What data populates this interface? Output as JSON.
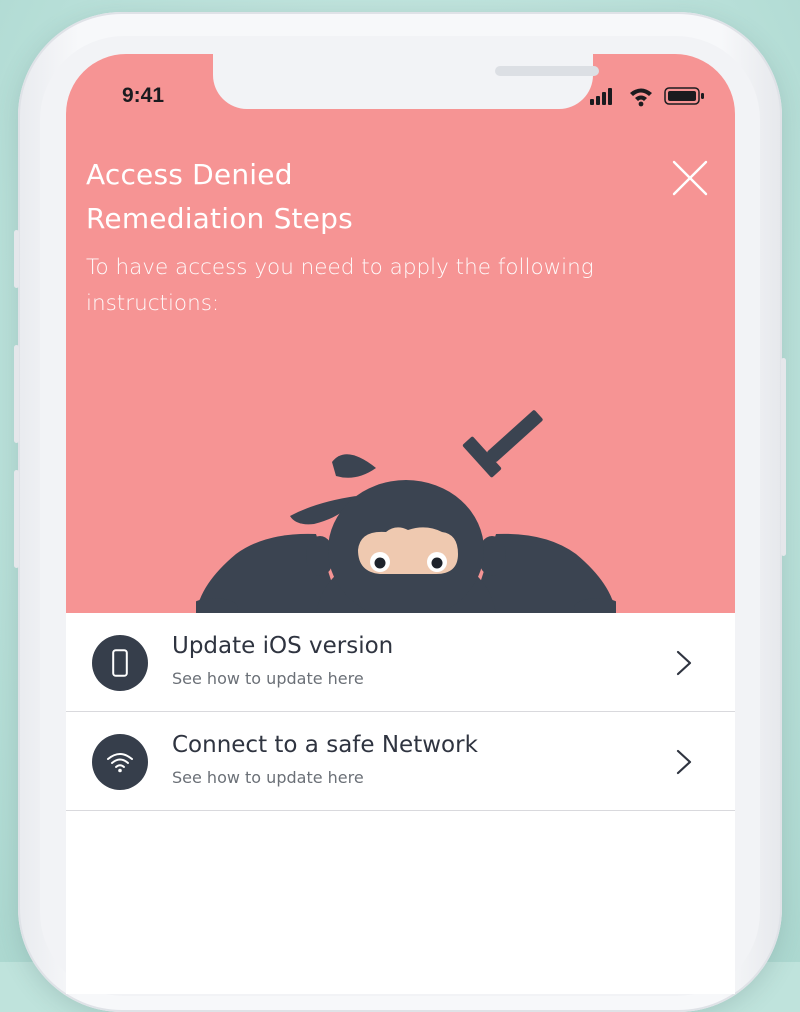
{
  "status_bar": {
    "time": "9:41",
    "icons": [
      "cellular-signal-icon",
      "wifi-icon",
      "battery-icon"
    ]
  },
  "header": {
    "title_line1": "Access Denied",
    "title_line2": "Remediation Steps",
    "subtitle": "To have access you need to apply the following instructions:",
    "close_icon": "close-icon",
    "illustration": "ninja-illustration"
  },
  "remediation_items": [
    {
      "icon": "phone-icon",
      "title": "Update iOS version",
      "subtitle": "See how to update here"
    },
    {
      "icon": "wifi-icon",
      "title": "Connect to a safe Network",
      "subtitle": "See how to update here"
    }
  ],
  "colors": {
    "header_bg": "#f69494",
    "icon_bg": "#363e4b",
    "ninja": "#3b4451",
    "ninja_face": "#efc9b0",
    "background": "#bfe3dc"
  }
}
